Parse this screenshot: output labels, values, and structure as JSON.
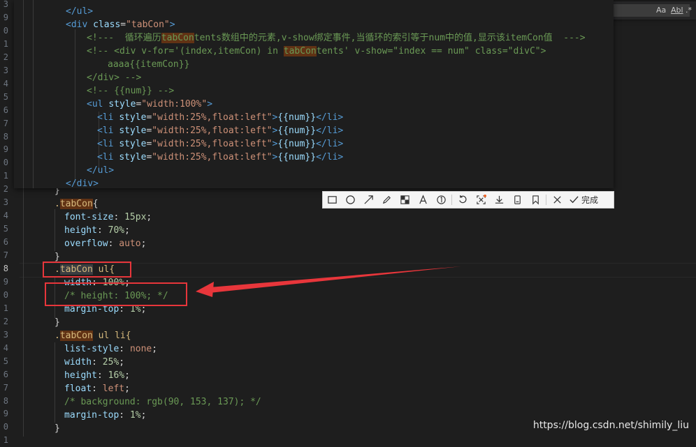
{
  "editor": {
    "gutter_lines": [
      "3",
      "9",
      "0",
      "1",
      "2",
      "3",
      "4",
      "5",
      "6",
      "7",
      "8",
      "9",
      "0",
      "1",
      "2",
      "3",
      "4",
      "5",
      "6",
      "7",
      "8",
      "9",
      "0",
      "1",
      "2",
      "3",
      "4",
      "5",
      "6",
      "7",
      "8",
      "9",
      "0",
      "1"
    ],
    "active_line_index": 20
  },
  "popup": {
    "l1": "</ul>",
    "l2_tag": "<div",
    "l2_attr": "class",
    "l2_val": "\"tabCon\"",
    "l3_a": "<!---  循环遍历",
    "l3_hl": "tabCon",
    "l3_b": "tents数组中的元素,v-show绑定事件,当循环的索引等于num中的值,显示该itemCon值  --->",
    "l4_a": "<!-- <div v-for='(index,itemCon) in ",
    "l4_hl": "tabCon",
    "l4_b": "tents' v-show=\"index == num\" class=\"divC\">",
    "l5": "aaaa{{itemCon}}",
    "l6": "</div> -->",
    "l7": "<!-- {{num}} -->",
    "l8_tag": "<ul",
    "l8_attr": "style",
    "l8_val": "\"width:100%\"",
    "li_tag": "<li",
    "li_attr": "style",
    "li_val": "\"width:25%,float:left\"",
    "li_text": "{{num}}",
    "li_close": "</li>",
    "l13": "</ul>",
    "l14": "</div>"
  },
  "css": {
    "brace_close": "}",
    "sel1_dot": ".",
    "sel1_name": "tabCon",
    "sel1_rest": "{",
    "p_font_size": "font-size",
    "v_font_size": "15px",
    "p_height": "height",
    "v_height1": "70%",
    "p_overflow": "overflow",
    "v_overflow": "auto",
    "sel2_name": "tabCon",
    "sel2_rest": " ul{",
    "p_width": "width",
    "v_width1": "100%",
    "comment_height": "/* height: 100%; */",
    "p_margin_top": "margin-top",
    "v_margin1": "1%",
    "sel3_name": "tabCon",
    "sel3_rest": " ul li{",
    "p_list_style": "list-style",
    "v_list_style": "none",
    "v_width2": "25%",
    "v_height2": "16%",
    "p_float": "float",
    "v_float": "left",
    "comment_bg": "/* background: rgb(90, 153, 137); */",
    "v_margin2": "1%"
  },
  "toolbar": {
    "icons": [
      "rectangle-icon",
      "circle-icon",
      "arrow-icon",
      "pen-icon",
      "mosaic-icon",
      "text-icon",
      "number-icon",
      "undo-icon",
      "ocr-icon",
      "download-icon",
      "pin-icon",
      "bookmark-icon",
      "close-icon",
      "check-icon"
    ],
    "done_label": "完成"
  },
  "findbar": {
    "opt_case": "Aa",
    "opt_word": "Abl",
    "opt_regex": ".*"
  },
  "watermark": "https://blog.csdn.net/shimily_liu",
  "colors": {
    "annotation_red": "#e8363b",
    "highlight": "#613214"
  }
}
